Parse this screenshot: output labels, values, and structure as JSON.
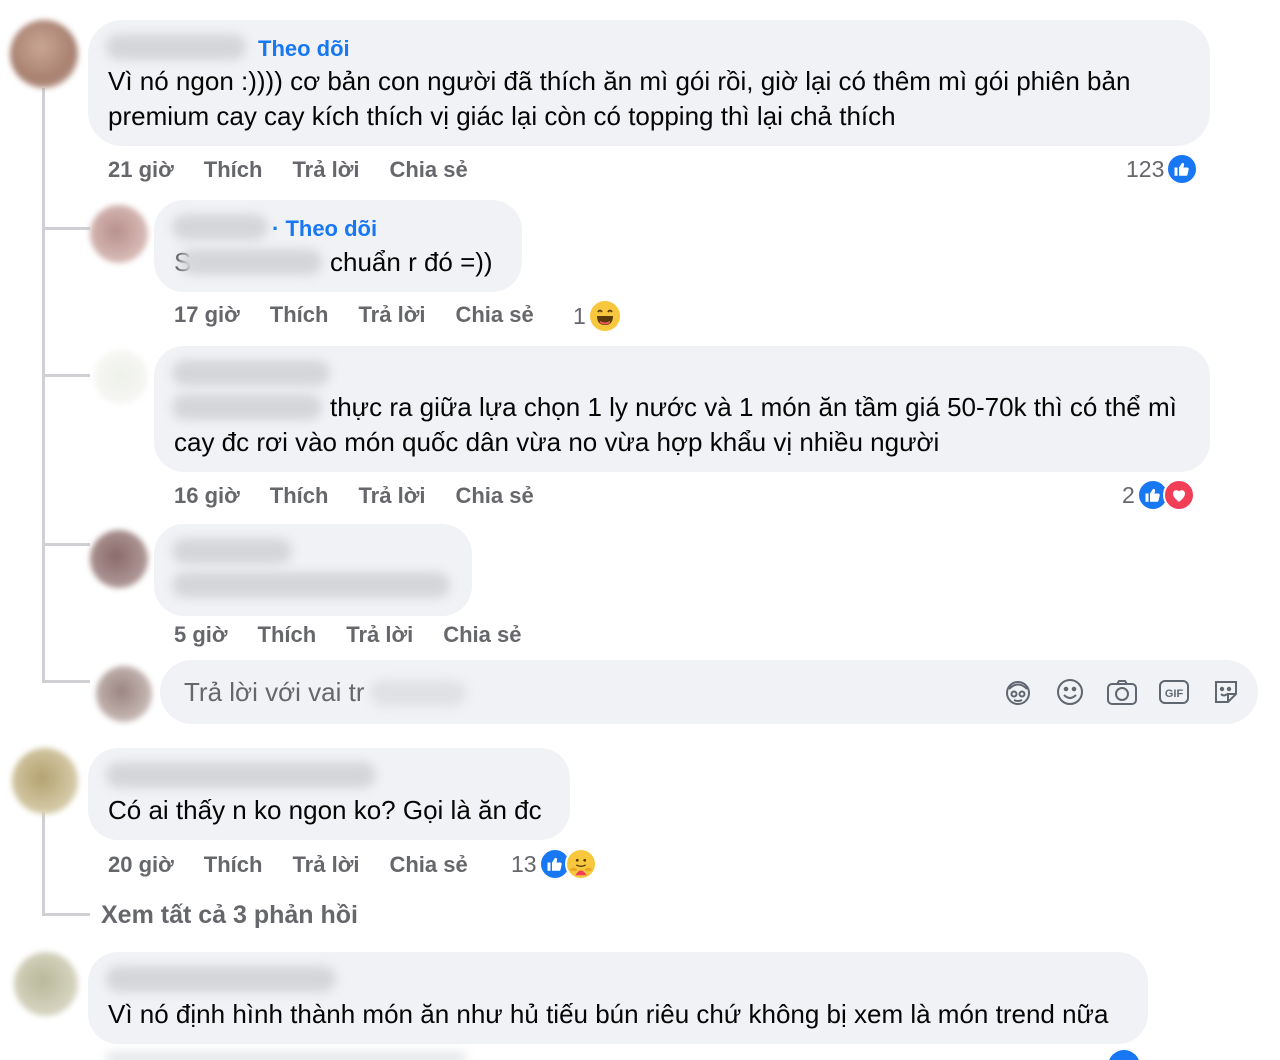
{
  "comments": [
    {
      "follow_label": "Theo dõi",
      "text_line1": "Vì nó ngon :)))) cơ bản con người đã thích ăn mì gói rồi, giờ lại có thêm mì gói phiên bản",
      "text_line2": "premium cay cay kích thích vị giác lại còn có topping thì lại chả thích",
      "time": "21 giờ",
      "like": "Thích",
      "reply": "Trả lời",
      "share": "Chia sẻ",
      "reaction_count": "123",
      "reactions": [
        "like-icon"
      ]
    },
    {
      "follow_label": "· Theo dõi",
      "text_prefix": "S",
      "text_line1": "chuẩn r đó =))",
      "time": "17 giờ",
      "like": "Thích",
      "reply": "Trả lời",
      "share": "Chia sẻ",
      "reaction_count": "1",
      "reactions": [
        "haha-icon"
      ]
    },
    {
      "text_line1": "thực ra giữa lựa chọn 1 ly nước và 1 món ăn tầm giá 50-70k thì có thể mì",
      "text_line2": "cay đc rơi vào món quốc dân vừa no vừa hợp khẩu vị nhiều người",
      "time": "16 giờ",
      "like": "Thích",
      "reply": "Trả lời",
      "share": "Chia sẻ",
      "reaction_count": "2",
      "reactions": [
        "like-icon",
        "love-icon"
      ]
    },
    {
      "time": "5 giờ",
      "like": "Thích",
      "reply": "Trả lời",
      "share": "Chia sẻ"
    },
    {
      "text_line1": "Có ai thấy n ko ngon ko? Gọi là ăn đc",
      "time": "20 giờ",
      "like": "Thích",
      "reply": "Trả lời",
      "share": "Chia sẻ",
      "reaction_count": "13",
      "reactions": [
        "like-icon",
        "care-icon"
      ]
    },
    {
      "text_line1": "Vì nó định hình thành món ăn như hủ tiếu bún riêu chứ không bị xem là món trend nữa"
    }
  ],
  "reply_composer": {
    "placeholder": "Trả lời với vai tr",
    "tools": [
      "avatar-sticker-icon",
      "emoji-icon",
      "camera-icon",
      "gif-icon",
      "sticker-icon"
    ],
    "gif_label": "GIF"
  },
  "view_all_replies": "Xem tất cả 3 phản hồi",
  "colors": {
    "bubble": "#f0f2f5",
    "link_blue": "#1877f2",
    "secondary_text": "#65676b",
    "thread_line": "#ced0d4"
  }
}
